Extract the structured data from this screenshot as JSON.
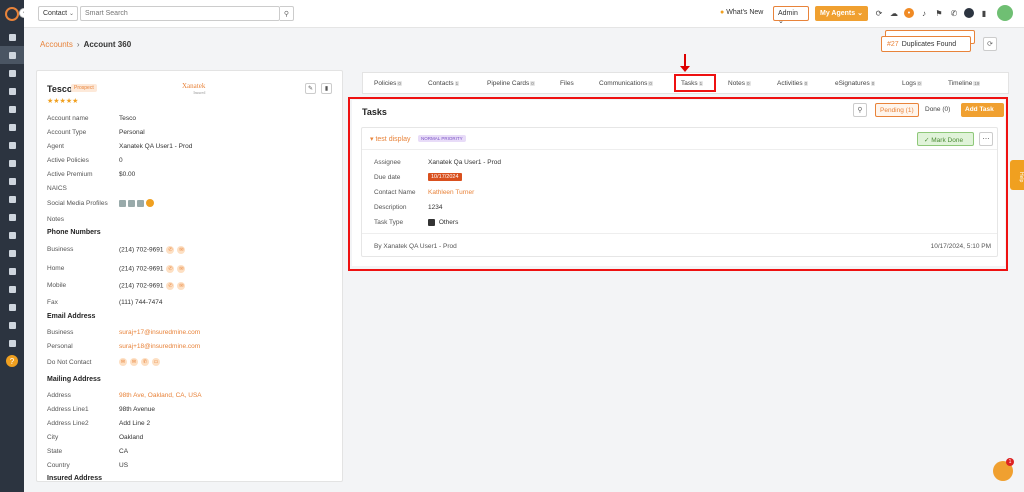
{
  "header": {
    "contact_type": "Contact",
    "search_placeholder": "Smart Search",
    "whats_new": "What's New",
    "role": "Admin",
    "my_agents": "My Agents"
  },
  "breadcrumb": {
    "parent": "Accounts",
    "current": "Account 360"
  },
  "duplicates": {
    "count": "#27",
    "label": "Duplicates Found"
  },
  "account": {
    "name": "Tesco",
    "badge": "Prospect",
    "stars": "★★★★★",
    "brand": "Xanatek",
    "brand_sub": "Insured",
    "fields": [
      {
        "label": "Account name",
        "value": "Tesco"
      },
      {
        "label": "Account Type",
        "value": "Personal"
      },
      {
        "label": "Agent",
        "value": "Xanatek QA User1 - Prod"
      },
      {
        "label": "Active Policies",
        "value": "0"
      },
      {
        "label": "Active Premium",
        "value": "$0.00"
      },
      {
        "label": "NAICS",
        "value": ""
      },
      {
        "label": "Social Media Profiles",
        "value": ""
      },
      {
        "label": "Notes",
        "value": ""
      }
    ],
    "phone_section": "Phone Numbers",
    "phones": [
      {
        "label": "Business",
        "value": "(214) 702-9691"
      },
      {
        "label": "Home",
        "value": "(214) 702-9691"
      },
      {
        "label": "Mobile",
        "value": "(214) 702-9691"
      },
      {
        "label": "Fax",
        "value": "(111) 744-7474"
      }
    ],
    "email_section": "Email Address",
    "emails": [
      {
        "label": "Business",
        "value": "suraj+17@insuredmine.com"
      },
      {
        "label": "Personal",
        "value": "suraj+18@insuredmine.com"
      },
      {
        "label": "Do Not Contact",
        "value": ""
      }
    ],
    "mailing_section": "Mailing Address",
    "mailing": [
      {
        "label": "Address",
        "value": "98th Ave, Oakland, CA, USA"
      },
      {
        "label": "Address Line1",
        "value": "98th Avenue"
      },
      {
        "label": "Address Line2",
        "value": "Add Line 2"
      },
      {
        "label": "City",
        "value": "Oakland"
      },
      {
        "label": "State",
        "value": "CA"
      },
      {
        "label": "Country",
        "value": "US"
      }
    ],
    "insured_section": "Insured Address"
  },
  "tabs": [
    {
      "label": "Policies",
      "count": "0"
    },
    {
      "label": "Contacts",
      "count": "1"
    },
    {
      "label": "Pipeline Cards",
      "count": "0"
    },
    {
      "label": "Files",
      "count": ""
    },
    {
      "label": "Communications",
      "count": "0"
    },
    {
      "label": "Tasks",
      "count": "1"
    },
    {
      "label": "Notes",
      "count": "0"
    },
    {
      "label": "Activities",
      "count": "0"
    },
    {
      "label": "eSignatures",
      "count": "0"
    },
    {
      "label": "Logs",
      "count": "0"
    },
    {
      "label": "Timeline",
      "count": "19"
    }
  ],
  "tasks": {
    "title": "Tasks",
    "pending": "Pending (1)",
    "done": "Done (0)",
    "add": "Add Task",
    "item": {
      "name": "test display",
      "priority": "NORMAL PRIORITY",
      "mark_done": "Mark Done",
      "assignee_label": "Assignee",
      "assignee": "Xanatek Qa User1 - Prod",
      "due_label": "Due date",
      "due": "10/17/2024",
      "contact_label": "Contact Name",
      "contact": "Kathleen Turner",
      "desc_label": "Description",
      "desc": "1234",
      "type_label": "Task Type",
      "type": "Others",
      "by": "By Xanatek QA User1 - Prod",
      "timestamp": "10/17/2024, 5:10 PM"
    }
  },
  "help_tab": "Help",
  "chat_count": "1"
}
